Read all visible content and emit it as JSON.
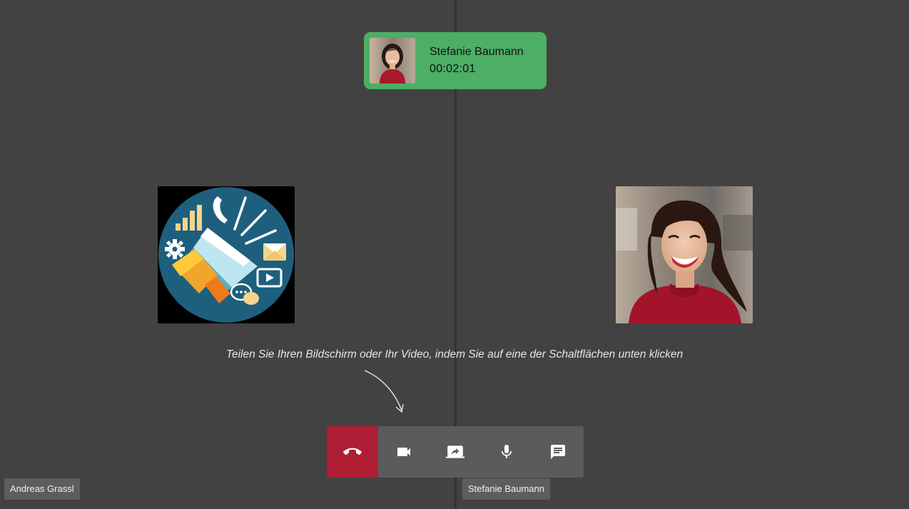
{
  "call": {
    "caller_name": "Stefanie Baumann",
    "duration": "00:02:01"
  },
  "hint": {
    "text": "Teilen Sie Ihren Bildschirm oder Ihr Video, indem Sie auf eine der Schaltflächen unten klicken"
  },
  "participants": {
    "left_name": "Andreas Grassl",
    "right_name": "Stefanie Baumann"
  },
  "controls": [
    {
      "icon": "hangup-icon",
      "active": true
    },
    {
      "icon": "video-camera-icon"
    },
    {
      "icon": "screen-share-icon"
    },
    {
      "icon": "microphone-icon"
    },
    {
      "icon": "chat-icon"
    }
  ],
  "colors": {
    "background": "#424242",
    "call_card": "#4caf64",
    "hangup": "#b01e35",
    "control_bar": "#5b5b5b"
  }
}
